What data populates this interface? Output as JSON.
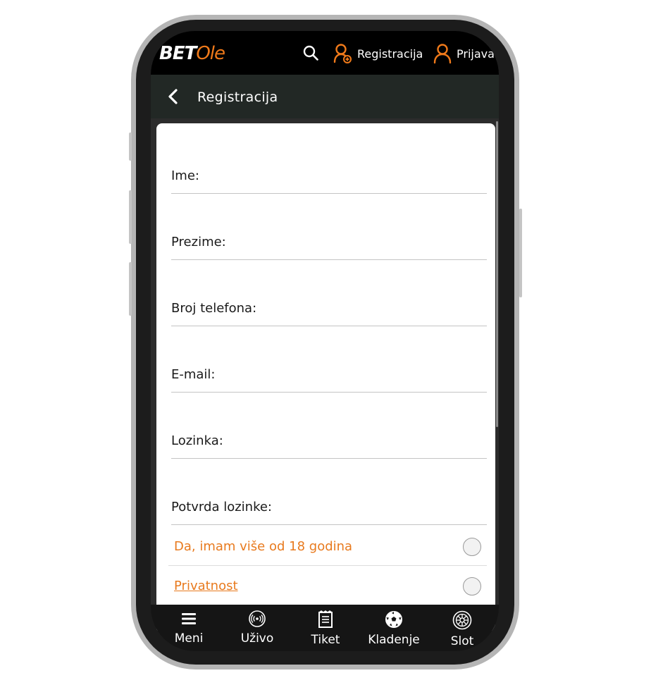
{
  "header": {
    "logo_bet": "BET",
    "logo_ole": "Ole",
    "register_label": "Registracija",
    "login_label": "Prijava",
    "accent_color": "#f07a1a"
  },
  "subheader": {
    "title": "Registracija"
  },
  "form": {
    "fields": [
      {
        "label": "Ime:",
        "value": ""
      },
      {
        "label": "Prezime:",
        "value": ""
      },
      {
        "label": "Broj telefona:",
        "value": ""
      },
      {
        "label": "E-mail:",
        "value": ""
      },
      {
        "label": "Lozinka:",
        "value": ""
      },
      {
        "label": "Potvrda lozinke:",
        "value": ""
      }
    ],
    "checks": [
      {
        "label": "Da, imam više od 18 godina",
        "checked": false
      },
      {
        "label": "Privatnost",
        "checked": false
      }
    ]
  },
  "bottom_nav": [
    {
      "label": "Meni",
      "icon": "menu-icon"
    },
    {
      "label": "Uživo",
      "icon": "live-icon"
    },
    {
      "label": "Tiket",
      "icon": "ticket-icon"
    },
    {
      "label": "Kladenje",
      "icon": "football-icon"
    },
    {
      "label": "Slot",
      "icon": "roulette-icon"
    }
  ]
}
